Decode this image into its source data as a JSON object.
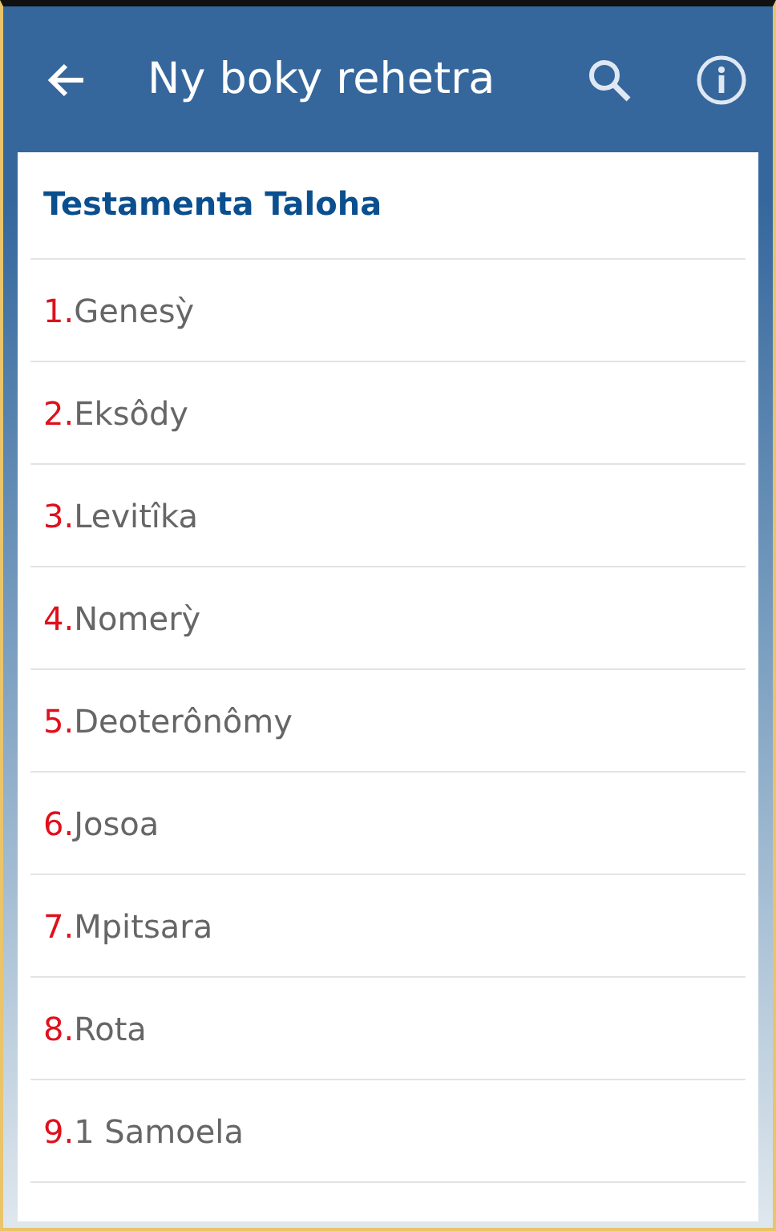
{
  "app_bar": {
    "title": "Ny boky rehetra"
  },
  "section": {
    "title": "Testamenta Taloha"
  },
  "books": [
    {
      "number": "1.",
      "name": "Genesỳ"
    },
    {
      "number": "2.",
      "name": "Eksôdy"
    },
    {
      "number": "3.",
      "name": "Levitîka"
    },
    {
      "number": "4.",
      "name": "Nomerỳ"
    },
    {
      "number": "5.",
      "name": "Deoterônômy"
    },
    {
      "number": "6.",
      "name": "Josoa"
    },
    {
      "number": "7.",
      "name": "Mpitsara"
    },
    {
      "number": "8.",
      "name": "Rota"
    },
    {
      "number": "9.",
      "name": "1 Samoela"
    }
  ]
}
